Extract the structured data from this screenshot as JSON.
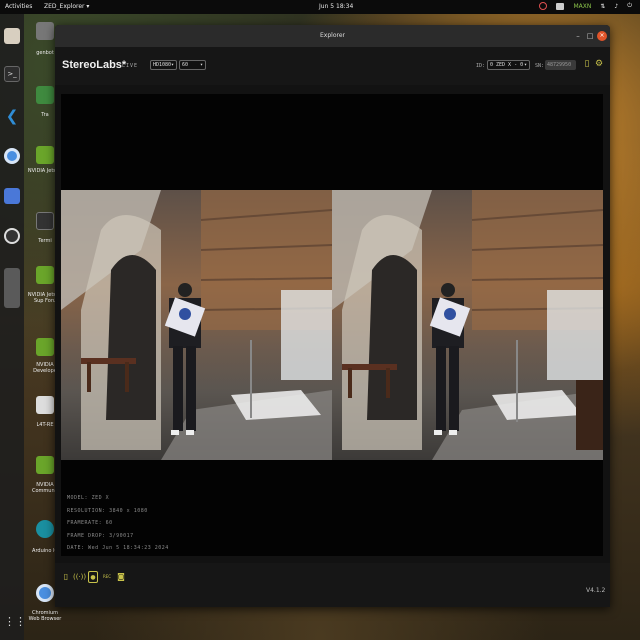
{
  "topbar": {
    "activities": "Activities",
    "app_menu": "ZED_Explorer ▾",
    "clock": "Jun 5  18:34",
    "tray_label": "MAXN"
  },
  "desktop": {
    "icons": [
      {
        "label": "genbot",
        "icon": "home-folder-icon"
      },
      {
        "label": "Tra",
        "icon": "trash-icon"
      },
      {
        "label": "NVIDIA Jetson",
        "icon": "nvidia-icon"
      },
      {
        "label": "Termi",
        "icon": "terminal-icon"
      },
      {
        "label": "NVIDIA Jetson Sup Foru",
        "icon": "nvidia-icon"
      },
      {
        "label": "NVIDIA Develope",
        "icon": "nvidia-icon"
      },
      {
        "label": "L4T-RE",
        "icon": "document-icon"
      },
      {
        "label": "NVIDIA Communit",
        "icon": "nvidia-icon"
      },
      {
        "label": "Arduino IC",
        "icon": "arduino-icon"
      },
      {
        "label": "Chromium Web Browser",
        "icon": "chromium-icon"
      }
    ]
  },
  "dock": {
    "items": [
      "files-icon",
      "terminal-icon",
      "vscode-icon",
      "chromium-icon",
      "screenshot-icon",
      "obs-icon",
      "app-grid-icon"
    ]
  },
  "window": {
    "title": "Explorer",
    "minimize": "–",
    "maximize": "□",
    "close": "×"
  },
  "app": {
    "logo": "StereoLabs*",
    "live_label": "LIVE",
    "resolution_select": "HD1080",
    "fps_select": "60",
    "id_label": "ID:",
    "camera_select": "0 ZED X - 0",
    "sn_label": "SN:",
    "sn_value": "48729950"
  },
  "info": {
    "model": "MODEL: ZED X",
    "resolution": "RESOLUTION: 3840 x 1080",
    "framerate": "FRAMERATE: 60",
    "frame_drop": "FRAME DROP: 3/90017",
    "date": "DATE: Wed Jun 5 18:34:23 2024"
  },
  "toolbar": {
    "tools": [
      "folder-icon",
      "stream-icon",
      "record-icon",
      "recording-mode-icon",
      "snapshot-icon"
    ],
    "record_mode_label": "REC",
    "version": "V4.1.2"
  },
  "colors": {
    "accent": "#c8c24a",
    "close_button": "#e0542a",
    "panel": "#161616",
    "viewer": "#030303"
  }
}
